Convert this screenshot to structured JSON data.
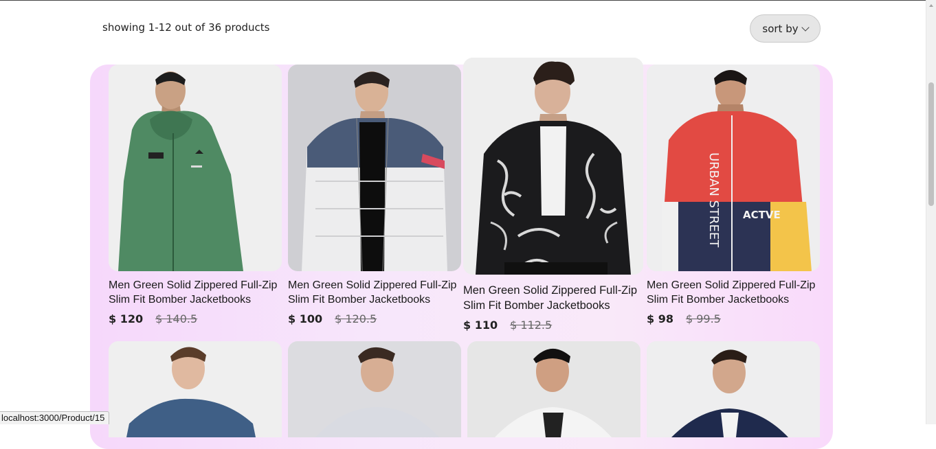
{
  "listing": {
    "showing_text": "showing 1-12 out of 36 products",
    "sort_label": "sort by"
  },
  "products": [
    {
      "title": "Men Green Solid Zippered Full-Zip Slim Fit Bomber Jacketbooks",
      "price": "$ 120",
      "old_price": "$ 140.5",
      "image_desc": "green hooded zip jacket"
    },
    {
      "title": "Men Green Solid Zippered Full-Zip Slim Fit Bomber Jacketbooks",
      "price": "$ 100",
      "old_price": "$ 120.5",
      "image_desc": "white and navy puffer jacket"
    },
    {
      "title": "Men Green Solid Zippered Full-Zip Slim Fit Bomber Jacketbooks",
      "price": "$ 110",
      "old_price": "$ 112.5",
      "image_desc": "black and white marble bomber jacket"
    },
    {
      "title": "Men Green Solid Zippered Full-Zip Slim Fit Bomber Jacketbooks",
      "price": "$ 98",
      "old_price": "$ 99.5",
      "image_desc": "red navy yellow colourblock jacket"
    }
  ],
  "jacket_prints": {
    "vertical": "URBAN STREET",
    "chest": "ACTVE"
  },
  "status_bar": {
    "url": "localhost:3000/Product/15"
  },
  "colors": {
    "panel": "#f7e2fb",
    "sort_bg": "#e6e6e6"
  }
}
